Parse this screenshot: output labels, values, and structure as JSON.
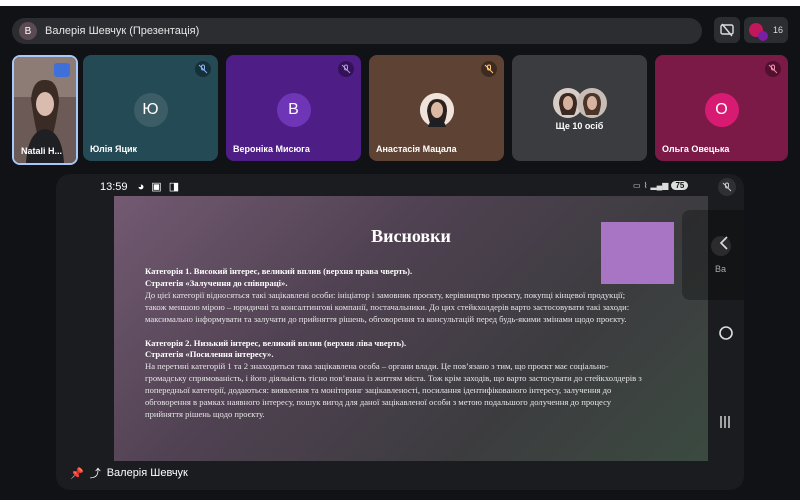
{
  "presenter_bar": {
    "avatar_letter": "В",
    "title": "Валерія Шевчук (Презентація)"
  },
  "participants_count": "16",
  "participants": [
    {
      "name": "Natali H...",
      "kind": "video",
      "muted": false
    },
    {
      "name": "Юлія Яцик",
      "kind": "initial",
      "initial": "Ю",
      "muted": true,
      "color": "#234a55"
    },
    {
      "name": "Вероніка Мисюга",
      "kind": "initial",
      "initial": "В",
      "muted": true,
      "color": "#4f1d86"
    },
    {
      "name": "Анастасія Мацала",
      "kind": "photo",
      "muted": true,
      "color": "#5e4234"
    },
    {
      "name": "Ще 10 осіб",
      "kind": "group",
      "muted": false,
      "color": "#3b3c3f"
    },
    {
      "name": "Ольга Овецька",
      "kind": "initial",
      "initial": "О",
      "muted": true,
      "color": "#7b1947"
    }
  ],
  "phone_status": {
    "time": "13:59",
    "battery": "75"
  },
  "slide": {
    "title": "Висновки",
    "paragraphs": [
      {
        "heading": "Категорія 1. Високий інтерес, великий вплив (верхня права чверть).",
        "strategy": "Стратегія «Залучення до співпраці».",
        "body": "До цієї категорії відносяться такі зацікавлені особи: ініціатор і замовник проєкту, керівництво проєкту, покупці кінцевої продукції; також меншою мірою – юридичні та консалтингові компанії, постачальники. До цих стейкхолдерів варто застосовувати такі заходи: максимально інформувати та залучати до прийняття рішень, обговорення та консультацій перед будь-якими змінами щодо проєкту."
      },
      {
        "heading": "Категорія 2. Низький інтерес, великий вплив (верхня ліва чверть).",
        "strategy": "Стратегія «Посилення інтересу».",
        "body": "На перетині категорій 1 та 2 знаходиться така зацікавлена особа – органи влади. Це пов’язано з тим, що проєкт має соціально-громадську спрямованість, і його діяльність тісно пов’язана із життям міста. Тож крім заходів, що варто застосувати до стейкхолдерів з попередньої категорії, додаються: виявлення та моніторинг зацікавленості, посилання ідентифікованого інтересу, залучення до обговорення в рамках наявного інтересу, пошук вигод для даної зацікавленої особи з метою подальшого долучення до процесу прийняття рішень щодо проєкту."
      }
    ]
  },
  "presenter_name": "Валерія Шевчук",
  "side_panel_text": "Ва",
  "colors": {
    "background": "#111215",
    "panel": "#2b2d31",
    "slide_accent": "#a874c4"
  }
}
